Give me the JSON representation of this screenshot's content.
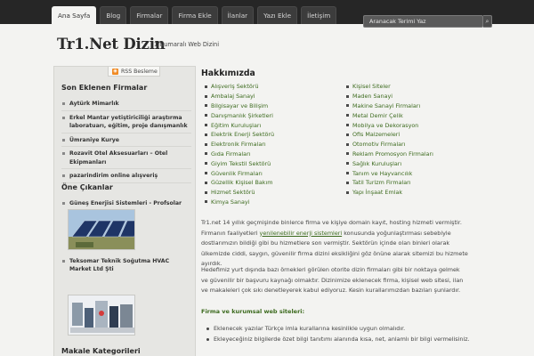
{
  "nav": {
    "items": [
      "Ana Sayfa",
      "Blog",
      "Firmalar",
      "Firma Ekle",
      "İlanlar",
      "Yazı Ekle",
      "İletişim"
    ],
    "active_index": 0
  },
  "search": {
    "placeholder": "Aranacak Terimi Yaz"
  },
  "header": {
    "title": "Tr1.Net Dizin",
    "tagline": "1 Numaralı Web Dizini"
  },
  "sidebar": {
    "rss_label": "RSS Besleme",
    "recent_heading": "Son Eklenen Firmalar",
    "recent_items": [
      "Aytürk Mimarlık",
      "Erkel Mantar yetiştiriciliği araştırma laboratuarı, eğitim, proje danışmanlık",
      "Ümraniye Kurye",
      "Rozavit Otel Aksesuarları – Otel Ekipmanları",
      "pazarindirim online alışveriş"
    ],
    "featured_heading": "Öne Çıkanlar",
    "featured": [
      "Güneş Enerjisi Sistemleri - Profsolar",
      "Teksomar Teknik Soğutma HVAC Market Ltd Şti"
    ],
    "categories_heading": "Makale Kategorileri"
  },
  "main": {
    "heading": "Hakkımızda",
    "links_col1": [
      "Alışveriş Sektörü",
      "Ambalaj Sanayi",
      "Bilgisayar ve Bilişim",
      "Danışmanlık Şirketleri",
      "Eğitim Kuruluşları",
      "Elektrik Enerji Sektörü",
      "Elektronik Firmaları",
      "Gıda Firmaları",
      "Giyim Tekstil Sektörü",
      "Güvenlik Firmaları",
      "Güzellik Kişisel Bakım",
      "Hizmet Sektörü",
      "Kimya Sanayi"
    ],
    "links_col2": [
      "Kişisel Siteler",
      "Maden Sanayi",
      "Makine Sanayi Firmaları",
      "Metal Demir Çelik",
      "Mobilya ve Dekorasyon",
      "Ofis Malzemeleri",
      "Otomotiv Firmaları",
      "Reklam Promosyon Firmaları",
      "Sağlık Kuruluşları",
      "Tanım ve Hayvancılık",
      "Tatil Turizm Firmaları",
      "Yapı İnşaat Emlak"
    ],
    "para1_a": "Tr1.net 14 yıllık geçmişinde binlerce firma ve kişiye domain kayıt, hosting hizmeti vermiştir. Firmanın faaliyetleri ",
    "para1_link": "yenilenebilir enerji sistemleri",
    "para1_b": " konusunda yoğunlaştırması sebebiyle dostlarımızın bildiği gibi bu hizmetlere son vermiştir. Sektörün içinde olan binleri olarak ülkemizde ciddi, saygın, güvenilir firma dizini eksikliğini göz önüne alarak sitemizi bu hizmete ayırdık.",
    "para2": "Hedefimiz yurt dışında bazı örnekleri görülen otorite dizin firmaları gibi bir noktaya gelmek ve güvenilir bir başvuru kaynağı olmaktır. Dizinimize eklenecek firma, kişisel web sitesi, ilan ve makaleleri çok sıkı denetleyerek kabul ediyoruz. Kesin kurallarımızdan bazıları şunlardır.",
    "rules_heading": "Firma ve kurumsal web siteleri:",
    "rules": [
      "Eklenecek yazılar Türkçe imla kurallarına kesinlikle uygun olmalıdır.",
      "Ekleyeceğiniz bilgilerde özet bilgi tanıtımı alanında kısa, net, anlamlı bir bilgi vermelisiniz."
    ]
  },
  "colors": {
    "link": "#3d6b1f",
    "topbar": "#262626",
    "sidebar": "#e6e6e3"
  }
}
